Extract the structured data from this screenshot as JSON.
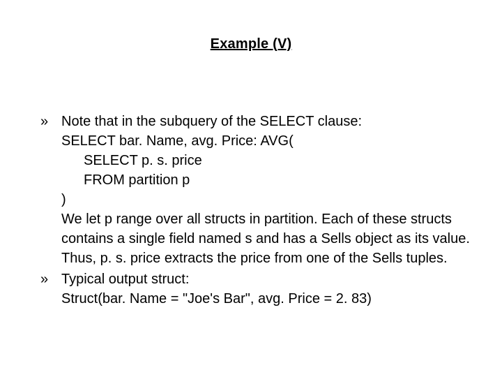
{
  "title": "Example (V)",
  "bullets": [
    {
      "marker": "»",
      "lines": [
        "Note that in the subquery of the SELECT clause:",
        "SELECT bar. Name, avg. Price: AVG("
      ],
      "indented": [
        "SELECT p. s. price",
        "FROM partition p"
      ],
      "tail": [
        ")",
        "We let p range over all structs in partition. Each of these structs contains a single field named s and has a Sells object as its value. Thus, p. s. price extracts the price from one of the Sells tuples."
      ]
    },
    {
      "marker": "»",
      "lines": [
        "Typical output struct:",
        "Struct(bar. Name = \"Joe's Bar\", avg. Price = 2. 83)"
      ],
      "indented": [],
      "tail": []
    }
  ]
}
